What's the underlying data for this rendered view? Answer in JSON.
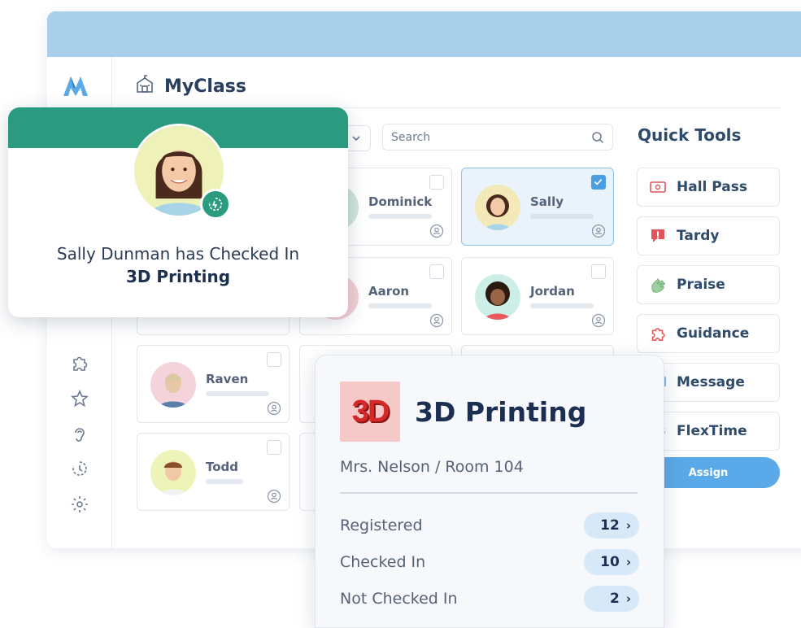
{
  "app": {
    "title": "MyClass"
  },
  "search": {
    "placeholder": "Search"
  },
  "students": [
    {
      "name": "Dominick",
      "checked": false
    },
    {
      "name": "Sally",
      "checked": true
    },
    {
      "name": "Aaron",
      "checked": false
    },
    {
      "name": "Jordan",
      "checked": false
    },
    {
      "name": "Raven",
      "checked": false
    },
    {
      "name": "Todd",
      "checked": false
    }
  ],
  "quick_tools": {
    "title": "Quick Tools",
    "items": [
      {
        "label": "Hall Pass",
        "icon": "ticket-icon"
      },
      {
        "label": "Tardy",
        "icon": "alert-icon"
      },
      {
        "label": "Praise",
        "icon": "clap-icon"
      },
      {
        "label": "Guidance",
        "icon": "puzzle-icon"
      },
      {
        "label": "Message",
        "icon": "message-icon"
      },
      {
        "label": "FlexTime",
        "icon": "flextime-icon"
      }
    ],
    "assign_label": "Assign"
  },
  "notification": {
    "message": "Sally Dunman has Checked In",
    "class_name": "3D Printing"
  },
  "class_card": {
    "logo_text": "3D",
    "title": "3D Printing",
    "subtitle": "Mrs. Nelson / Room 104",
    "stats": [
      {
        "label": "Registered",
        "value": "12"
      },
      {
        "label": "Checked In",
        "value": "10"
      },
      {
        "label": "Not Checked In",
        "value": "2"
      }
    ]
  },
  "colors": {
    "top_bar": "#a9d0ea",
    "notify_band": "#2a9b7e",
    "accent_blue": "#5aa9e8",
    "selected_card": "#eaf3fc"
  }
}
